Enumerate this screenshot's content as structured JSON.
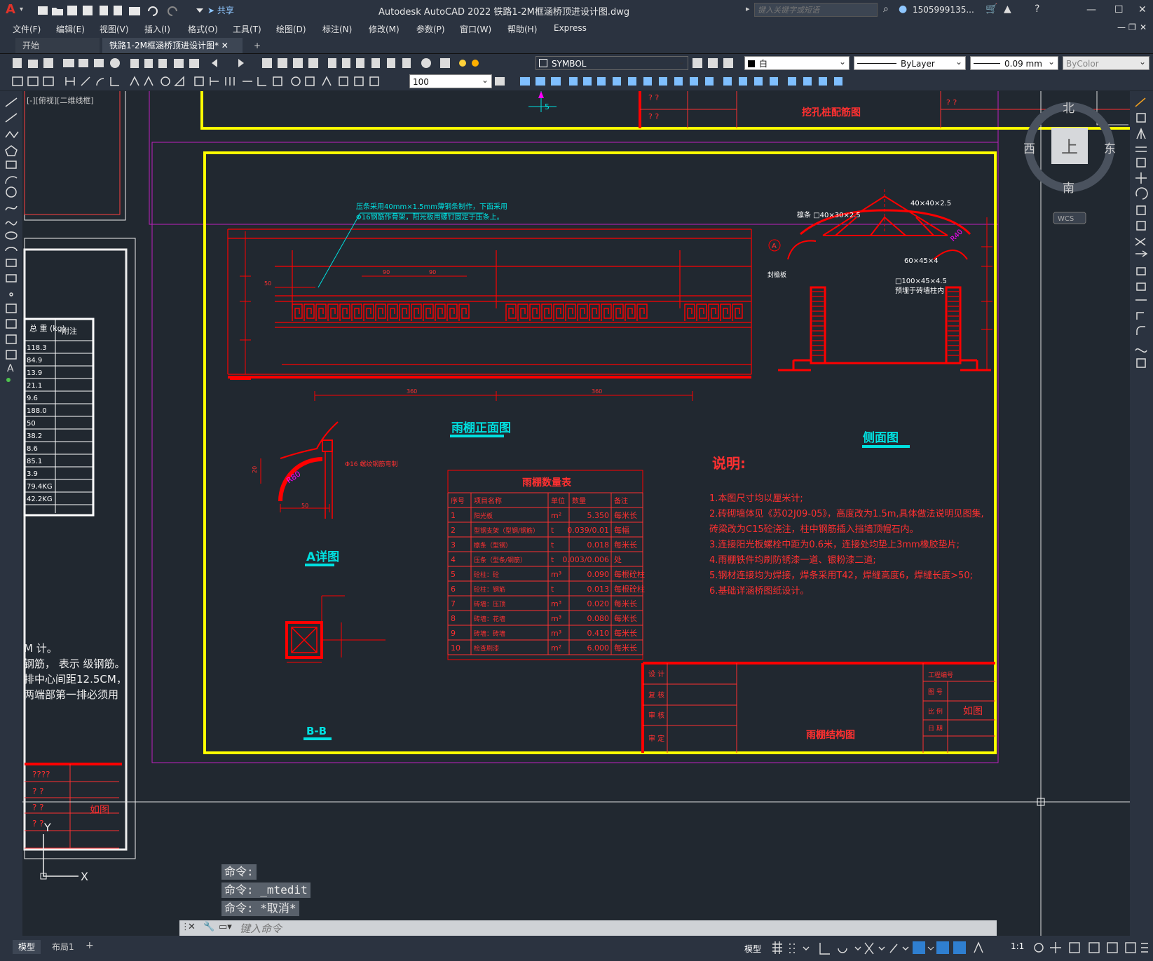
{
  "app": {
    "logo": "A",
    "title": "Autodesk AutoCAD 2022    铁路1-2M框涵桥顶进设计图.dwg"
  },
  "quick_access": {
    "share_label": "共享"
  },
  "search": {
    "placeholder": "键入关键字或短语"
  },
  "user": {
    "name": "1505999135..."
  },
  "window_buttons": {
    "minimize": "—",
    "maximize": "☐",
    "close": "✕"
  },
  "menu": [
    "文件(F)",
    "编辑(E)",
    "视图(V)",
    "插入(I)",
    "格式(O)",
    "工具(T)",
    "绘图(D)",
    "标注(N)",
    "修改(M)",
    "参数(P)",
    "窗口(W)",
    "帮助(H)",
    "Express"
  ],
  "tabs": {
    "start": "开始",
    "active": "铁路1-2M框涵桥顶进设计图*",
    "add": "+"
  },
  "toolbar": {
    "layer_name": "SYMBOL",
    "color": "白",
    "linetype": "ByLayer",
    "lineweight": "0.09 mm",
    "plotstyle": "ByColor",
    "scale": "100"
  },
  "viewcube": {
    "north": "北",
    "south": "南",
    "east": "东",
    "west": "西",
    "top": "上",
    "wcs": "WCS"
  },
  "viewport_label": "[-][俯视][二维线框]",
  "left_table": {
    "headers": [
      "总 重\n(kg)",
      "附注"
    ],
    "values": [
      "118.3",
      "84.9",
      "13.9",
      "21.1",
      "9.6",
      "188.0",
      "50",
      "38.2",
      "8.6",
      "85.1",
      "3.9",
      "79.4KG",
      "42.2KG"
    ]
  },
  "left_notes": [
    "M 计。",
    "钢筋，   表示    级钢筋。",
    "排中心间距12.5CM，",
    "两端部第一排必须用"
  ],
  "left_bottom_block": {
    "r1": "????",
    "r2": "?    ?",
    "r3": "?    ?",
    "r3b": "如图",
    "r4": "?    ?"
  },
  "top_block": {
    "q": "?    ?",
    "title": "挖孔桩配筋图",
    "dim": "5"
  },
  "drawing": {
    "front_view_title": "雨棚正面图",
    "side_view_title": "侧面图",
    "a_detail_title": "A详图",
    "bb_title": "B-B",
    "front_note1": "压条采用40mm×1.5mm薄钢条制作，下面采用",
    "front_note2": "Φ16钢筋作骨架，阳光板用螺钉固定于压条上。",
    "side_labels": {
      "l1": "40×40×2.5",
      "l2": "檩条 □40×30×2.5",
      "l3": "60×45×4",
      "l4": "□100×45×4.5",
      "l5": "预埋于砖墙柱内",
      "l6": "封檐板",
      "r": "R40",
      "a": "A"
    },
    "a_labels": {
      "r80": "R80",
      "note": "Φ16 螺纹钢筋弯制",
      "dim50": "50",
      "dim20": "20"
    },
    "front_dims": {
      "d50": "50",
      "d90a": "90",
      "d90b": "90",
      "d360a": "360",
      "d360b": "360"
    }
  },
  "qty_table": {
    "title": "雨棚数量表",
    "headers": [
      "序号",
      "项目名称",
      "单位",
      "数量",
      "备注"
    ],
    "rows": [
      [
        "1",
        "阳光板",
        "m²",
        "5.350",
        "每米长"
      ],
      [
        "2",
        "型钢支架（型钢/钢筋）",
        "t",
        "0.039/0.01",
        "每幅"
      ],
      [
        "3",
        "檩条（型钢）",
        "t",
        "0.018",
        "每米长"
      ],
      [
        "4",
        "压条（型条/钢筋）",
        "t",
        "0.003/0.006",
        "处"
      ],
      [
        "5",
        "砼柱：砼",
        "m³",
        "0.090",
        "每根砼柱"
      ],
      [
        "6",
        "砼柱：钢筋",
        "t",
        "0.013",
        "每根砼柱"
      ],
      [
        "7",
        "砖墙：压顶",
        "m³",
        "0.020",
        "每米长"
      ],
      [
        "8",
        "砖墙：花墙",
        "m³",
        "0.080",
        "每米长"
      ],
      [
        "9",
        "砖墙：砖墙",
        "m³",
        "0.410",
        "每米长"
      ],
      [
        "10",
        "检查刷漆",
        "m²",
        "6.000",
        "每米长"
      ]
    ]
  },
  "notes": {
    "title": "说明:",
    "items": [
      "1.本图尺寸均以厘米计;",
      "2.砖砌墙体见《苏02J09-05》，高度改为1.5m,具体做法说明见图集,",
      "砖梁改为C15砼浇注，柱中钢筋插入挡墙顶帽石内。",
      "3.连接阳光板螺栓中距为0.6米，连接处均垫上3mm橡胶垫片;",
      "4.雨棚铁件均刷防锈漆一道、银粉漆二道;",
      "5.钢材连接均为焊接，焊条采用T42，焊缝高度6，焊缝长度>50;",
      "6.基础详涵桥图纸设计。"
    ]
  },
  "title_block": {
    "r1": "设  计",
    "r2": "复  核",
    "r3": "审  核",
    "r4": "审  定",
    "drawing_name": "雨棚结构图",
    "project": "工程编号",
    "r_a": "图    号",
    "r_b": "比    例",
    "r_b_val": "如图",
    "r_c": "日    期"
  },
  "command_history": [
    "命令:",
    "命令: _mtedit",
    "命令: *取消*"
  ],
  "command_input": {
    "placeholder": "键入命令"
  },
  "ucs": {
    "x": "X",
    "y": "Y"
  },
  "layout_tabs": {
    "model": "模型",
    "layout1": "布局1",
    "add": "+"
  },
  "status": {
    "model": "模型",
    "scale": "1:1"
  }
}
